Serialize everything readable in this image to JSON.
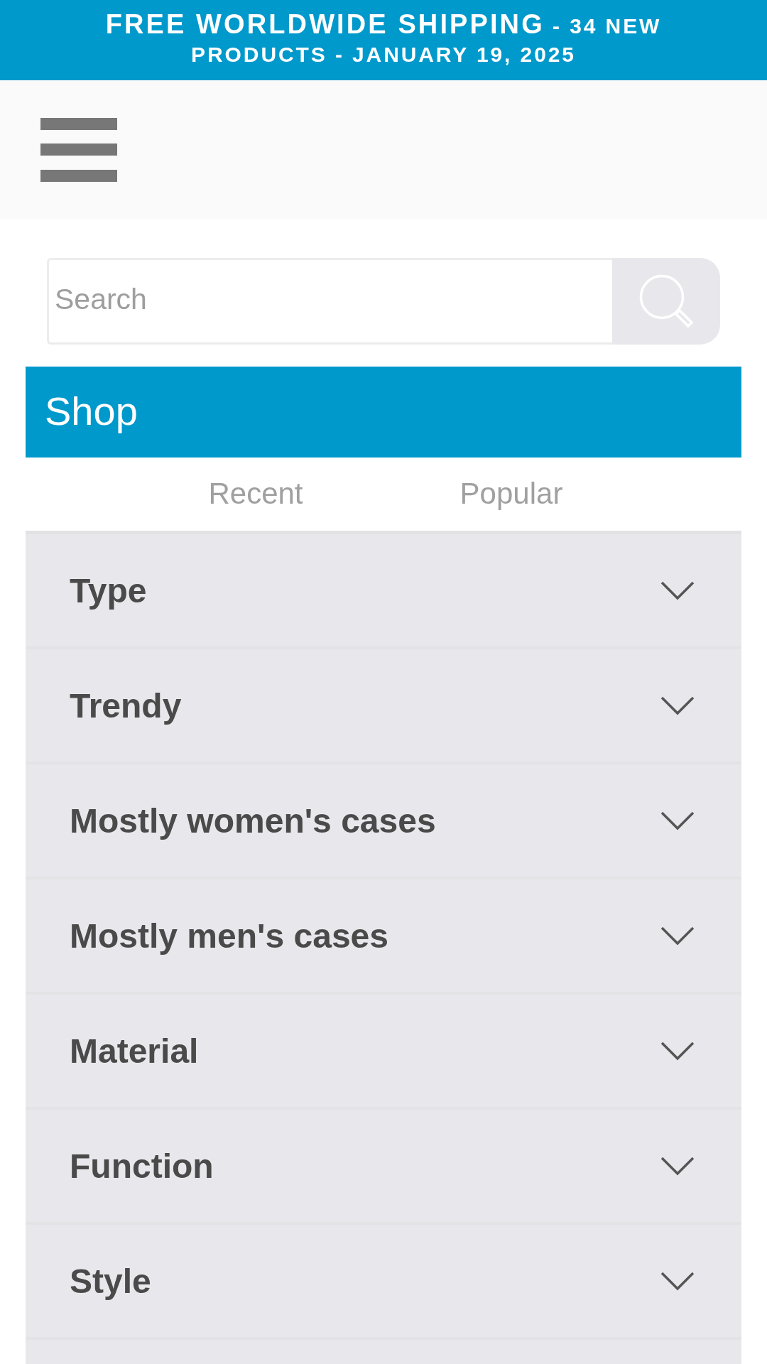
{
  "announcement_bar": {
    "headline": "FREE WORLDWIDE SHIPPING",
    "subline": "- 34 NEW PRODUCTS - JANUARY 19, 2025"
  },
  "search": {
    "placeholder": "Search"
  },
  "shop_panel": {
    "title": "Shop",
    "tabs": [
      {
        "label": "Recent",
        "selected": false
      },
      {
        "label": "Popular",
        "selected": false
      }
    ],
    "categories": [
      {
        "label": "Type",
        "expanded": false
      },
      {
        "label": "Trendy",
        "expanded": false
      },
      {
        "label": "Mostly women's cases",
        "expanded": false
      },
      {
        "label": "Mostly men's cases",
        "expanded": false
      },
      {
        "label": "Material",
        "expanded": false
      },
      {
        "label": "Function",
        "expanded": false
      },
      {
        "label": "Style",
        "expanded": false
      }
    ]
  }
}
